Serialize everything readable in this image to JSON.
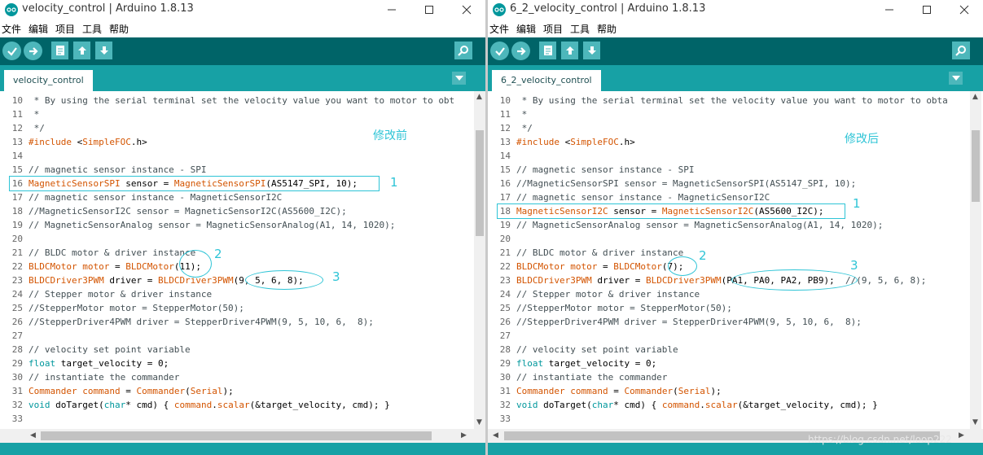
{
  "colors": {
    "toolbar": "#006468",
    "tabbar": "#17a1a5",
    "button": "#4db7bb",
    "annotation": "#2ec4d6",
    "comment": "#434f54",
    "keyword": "#d35400",
    "type": "#00979c"
  },
  "menu": [
    "文件",
    "编辑",
    "项目",
    "工具",
    "帮助"
  ],
  "windows": [
    {
      "title": "velocity_control | Arduino 1.8.13",
      "tab": "velocity_control",
      "annotation": "修改前",
      "markers": [
        "1",
        "2",
        "3"
      ],
      "lines": [
        {
          "n": "10",
          "segs": [
            {
              "c": "c",
              "t": " * By using the serial terminal set the velocity value you want to motor to obt"
            }
          ]
        },
        {
          "n": "11",
          "segs": [
            {
              "c": "c",
              "t": " *"
            }
          ]
        },
        {
          "n": "12",
          "segs": [
            {
              "c": "c",
              "t": " */"
            }
          ]
        },
        {
          "n": "13",
          "segs": [
            {
              "c": "k",
              "t": "#include"
            },
            {
              "c": "",
              "t": " <"
            },
            {
              "c": "k",
              "t": "SimpleFOC"
            },
            {
              "c": "",
              "t": ".h>"
            }
          ]
        },
        {
          "n": "14",
          "segs": []
        },
        {
          "n": "15",
          "segs": [
            {
              "c": "c",
              "t": "// magnetic sensor instance - SPI"
            }
          ]
        },
        {
          "n": "16",
          "segs": [
            {
              "c": "k",
              "t": "MagneticSensorSPI"
            },
            {
              "c": "",
              "t": " sensor = "
            },
            {
              "c": "k",
              "t": "MagneticSensorSPI"
            },
            {
              "c": "",
              "t": "(AS5147_SPI, 10);"
            }
          ]
        },
        {
          "n": "17",
          "segs": [
            {
              "c": "c",
              "t": "// magnetic sensor instance - MagneticSensorI2C"
            }
          ]
        },
        {
          "n": "18",
          "segs": [
            {
              "c": "c",
              "t": "//MagneticSensorI2C sensor = MagneticSensorI2C(AS5600_I2C);"
            }
          ]
        },
        {
          "n": "19",
          "segs": [
            {
              "c": "c",
              "t": "// MagneticSensorAnalog sensor = MagneticSensorAnalog(A1, 14, 1020);"
            }
          ]
        },
        {
          "n": "20",
          "segs": []
        },
        {
          "n": "21",
          "segs": [
            {
              "c": "c",
              "t": "// BLDC motor & driver instance"
            }
          ]
        },
        {
          "n": "22",
          "segs": [
            {
              "c": "k",
              "t": "BLDCMotor"
            },
            {
              "c": "",
              "t": " "
            },
            {
              "c": "k",
              "t": "motor"
            },
            {
              "c": "",
              "t": " = "
            },
            {
              "c": "k",
              "t": "BLDCMotor"
            },
            {
              "c": "",
              "t": "(11);"
            }
          ]
        },
        {
          "n": "23",
          "segs": [
            {
              "c": "k",
              "t": "BLDCDriver3PWM"
            },
            {
              "c": "",
              "t": " driver = "
            },
            {
              "c": "k",
              "t": "BLDCDriver3PWM"
            },
            {
              "c": "",
              "t": "(9, 5, 6, 8);"
            }
          ]
        },
        {
          "n": "24",
          "segs": [
            {
              "c": "c",
              "t": "// Stepper motor & driver instance"
            }
          ]
        },
        {
          "n": "25",
          "segs": [
            {
              "c": "c",
              "t": "//StepperMotor motor = StepperMotor(50);"
            }
          ]
        },
        {
          "n": "26",
          "segs": [
            {
              "c": "c",
              "t": "//StepperDriver4PWM driver = StepperDriver4PWM(9, 5, 10, 6,  8);"
            }
          ]
        },
        {
          "n": "27",
          "segs": []
        },
        {
          "n": "28",
          "segs": [
            {
              "c": "c",
              "t": "// velocity set point variable"
            }
          ]
        },
        {
          "n": "29",
          "segs": [
            {
              "c": "t",
              "t": "float"
            },
            {
              "c": "",
              "t": " target_velocity = 0;"
            }
          ]
        },
        {
          "n": "30",
          "segs": [
            {
              "c": "c",
              "t": "// instantiate the commander"
            }
          ]
        },
        {
          "n": "31",
          "segs": [
            {
              "c": "k",
              "t": "Commander"
            },
            {
              "c": "",
              "t": " "
            },
            {
              "c": "k",
              "t": "command"
            },
            {
              "c": "",
              "t": " = "
            },
            {
              "c": "k",
              "t": "Commander"
            },
            {
              "c": "",
              "t": "("
            },
            {
              "c": "k",
              "t": "Serial"
            },
            {
              "c": "",
              "t": ");"
            }
          ]
        },
        {
          "n": "32",
          "segs": [
            {
              "c": "t",
              "t": "void"
            },
            {
              "c": "",
              "t": " doTarget("
            },
            {
              "c": "t",
              "t": "char"
            },
            {
              "c": "",
              "t": "* cmd) { "
            },
            {
              "c": "k",
              "t": "command"
            },
            {
              "c": "",
              "t": "."
            },
            {
              "c": "k",
              "t": "scalar"
            },
            {
              "c": "",
              "t": "(&target_velocity, cmd); }"
            }
          ]
        },
        {
          "n": "33",
          "segs": []
        }
      ]
    },
    {
      "title": "6_2_velocity_control | Arduino 1.8.13",
      "tab": "6_2_velocity_control",
      "annotation": "修改后",
      "markers": [
        "1",
        "2",
        "3"
      ],
      "lines": [
        {
          "n": "10",
          "segs": [
            {
              "c": "c",
              "t": " * By using the serial terminal set the velocity value you want to motor to obta"
            }
          ]
        },
        {
          "n": "11",
          "segs": [
            {
              "c": "c",
              "t": " *"
            }
          ]
        },
        {
          "n": "12",
          "segs": [
            {
              "c": "c",
              "t": " */"
            }
          ]
        },
        {
          "n": "13",
          "segs": [
            {
              "c": "k",
              "t": "#include"
            },
            {
              "c": "",
              "t": " <"
            },
            {
              "c": "k",
              "t": "SimpleFOC"
            },
            {
              "c": "",
              "t": ".h>"
            }
          ]
        },
        {
          "n": "14",
          "segs": []
        },
        {
          "n": "15",
          "segs": [
            {
              "c": "c",
              "t": "// magnetic sensor instance - SPI"
            }
          ]
        },
        {
          "n": "16",
          "segs": [
            {
              "c": "c",
              "t": "//MagneticSensorSPI sensor = MagneticSensorSPI(AS5147_SPI, 10);"
            }
          ]
        },
        {
          "n": "17",
          "segs": [
            {
              "c": "c",
              "t": "// magnetic sensor instance - MagneticSensorI2C"
            }
          ]
        },
        {
          "n": "18",
          "segs": [
            {
              "c": "k",
              "t": "MagneticSensorI2C"
            },
            {
              "c": "",
              "t": " sensor = "
            },
            {
              "c": "k",
              "t": "MagneticSensorI2C"
            },
            {
              "c": "",
              "t": "(AS5600_I2C);"
            }
          ]
        },
        {
          "n": "19",
          "segs": [
            {
              "c": "c",
              "t": "// MagneticSensorAnalog sensor = MagneticSensorAnalog(A1, 14, 1020);"
            }
          ]
        },
        {
          "n": "20",
          "segs": []
        },
        {
          "n": "21",
          "segs": [
            {
              "c": "c",
              "t": "// BLDC motor & driver instance"
            }
          ]
        },
        {
          "n": "22",
          "segs": [
            {
              "c": "k",
              "t": "BLDCMotor"
            },
            {
              "c": "",
              "t": " "
            },
            {
              "c": "k",
              "t": "motor"
            },
            {
              "c": "",
              "t": " = "
            },
            {
              "c": "k",
              "t": "BLDCMotor"
            },
            {
              "c": "",
              "t": "(7);"
            }
          ]
        },
        {
          "n": "23",
          "segs": [
            {
              "c": "k",
              "t": "BLDCDriver3PWM"
            },
            {
              "c": "",
              "t": " driver = "
            },
            {
              "c": "k",
              "t": "BLDCDriver3PWM"
            },
            {
              "c": "",
              "t": "(PA1, PA0, PA2, PB9);  "
            },
            {
              "c": "c",
              "t": "//(9, 5, 6, 8);"
            }
          ]
        },
        {
          "n": "24",
          "segs": [
            {
              "c": "c",
              "t": "// Stepper motor & driver instance"
            }
          ]
        },
        {
          "n": "25",
          "segs": [
            {
              "c": "c",
              "t": "//StepperMotor motor = StepperMotor(50);"
            }
          ]
        },
        {
          "n": "26",
          "segs": [
            {
              "c": "c",
              "t": "//StepperDriver4PWM driver = StepperDriver4PWM(9, 5, 10, 6,  8);"
            }
          ]
        },
        {
          "n": "27",
          "segs": []
        },
        {
          "n": "28",
          "segs": [
            {
              "c": "c",
              "t": "// velocity set point variable"
            }
          ]
        },
        {
          "n": "29",
          "segs": [
            {
              "c": "t",
              "t": "float"
            },
            {
              "c": "",
              "t": " target_velocity = 0;"
            }
          ]
        },
        {
          "n": "30",
          "segs": [
            {
              "c": "c",
              "t": "// instantiate the commander"
            }
          ]
        },
        {
          "n": "31",
          "segs": [
            {
              "c": "k",
              "t": "Commander"
            },
            {
              "c": "",
              "t": " "
            },
            {
              "c": "k",
              "t": "command"
            },
            {
              "c": "",
              "t": " = "
            },
            {
              "c": "k",
              "t": "Commander"
            },
            {
              "c": "",
              "t": "("
            },
            {
              "c": "k",
              "t": "Serial"
            },
            {
              "c": "",
              "t": ");"
            }
          ]
        },
        {
          "n": "32",
          "segs": [
            {
              "c": "t",
              "t": "void"
            },
            {
              "c": "",
              "t": " doTarget("
            },
            {
              "c": "t",
              "t": "char"
            },
            {
              "c": "",
              "t": "* cmd) { "
            },
            {
              "c": "k",
              "t": "command"
            },
            {
              "c": "",
              "t": "."
            },
            {
              "c": "k",
              "t": "scalar"
            },
            {
              "c": "",
              "t": "(&target_velocity, cmd); }"
            }
          ]
        },
        {
          "n": "33",
          "segs": []
        }
      ]
    }
  ],
  "watermark": "https://blog.csdn.net/loop222"
}
